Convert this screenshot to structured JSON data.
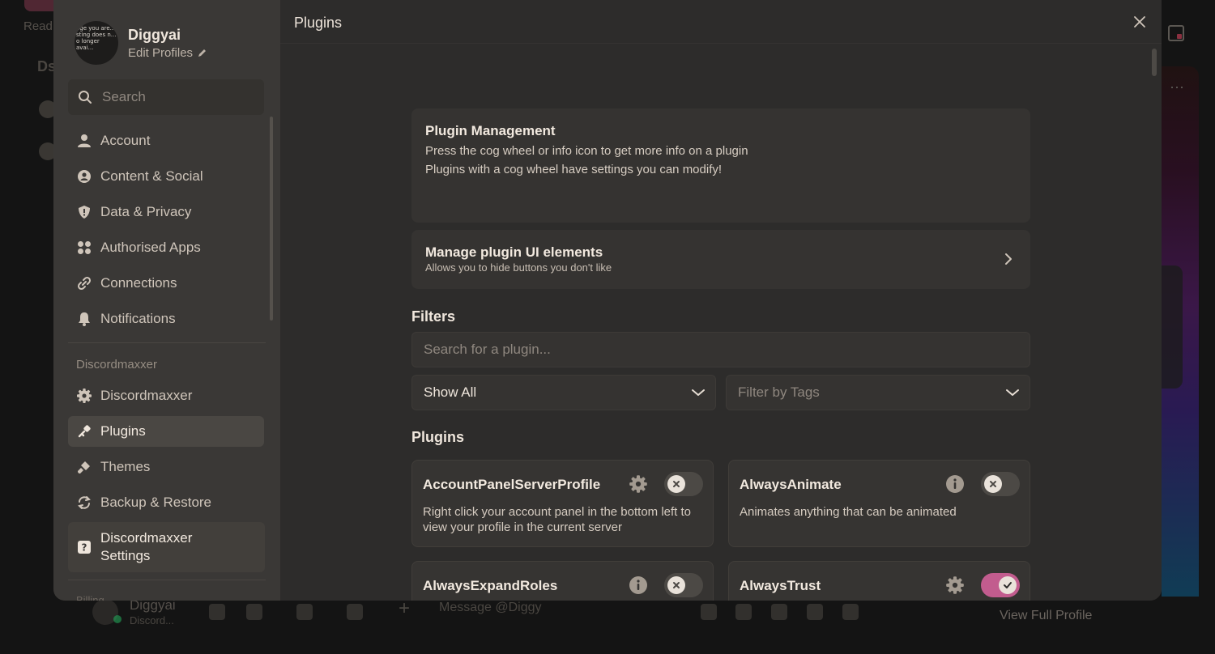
{
  "background": {
    "read_text": "Read",
    "ds_text": "Ds",
    "user": {
      "name": "Diggyai",
      "status": "Discord..."
    },
    "message_placeholder": "Message @Diggy",
    "view_full_profile": "View Full Profile"
  },
  "profile": {
    "name": "Diggyai",
    "edit_label": "Edit Profiles",
    "avatar_text": "age you are... sting does n... o longer avai..."
  },
  "sidebar": {
    "search_placeholder": "Search",
    "items": [
      {
        "label": "Account",
        "icon": "user-icon"
      },
      {
        "label": "Content & Social",
        "icon": "shield-user-icon"
      },
      {
        "label": "Data & Privacy",
        "icon": "shield-icon"
      },
      {
        "label": "Authorised Apps",
        "icon": "apps-icon"
      },
      {
        "label": "Connections",
        "icon": "link-icon"
      },
      {
        "label": "Notifications",
        "icon": "bell-icon"
      }
    ],
    "section_label": "Discordmaxxer",
    "section_items": [
      {
        "label": "Discordmaxxer",
        "icon": "gear-icon"
      },
      {
        "label": "Plugins",
        "icon": "puzzle-icon",
        "active": true
      },
      {
        "label": "Themes",
        "icon": "brush-icon"
      },
      {
        "label": "Backup & Restore",
        "icon": "sync-icon"
      },
      {
        "label": "Discordmaxxer Settings",
        "icon": "settings-box-icon"
      }
    ],
    "clipped_label": "Billing"
  },
  "main": {
    "title": "Plugins",
    "management": {
      "title": "Plugin Management",
      "line1": "Press the cog wheel or info icon to get more info on a plugin",
      "line2": "Plugins with a cog wheel have settings you can modify!"
    },
    "ui_elements": {
      "title": "Manage plugin UI elements",
      "subtitle": "Allows you to hide buttons you don't like"
    },
    "filters_heading": "Filters",
    "search_placeholder": "Search for a plugin...",
    "show_select": "Show All",
    "tags_placeholder": "Filter by Tags",
    "plugins_heading": "Plugins",
    "plugins": [
      {
        "name": "AccountPanelServerProfile",
        "description": "Right click your account panel in the bottom left to view your profile in the current server",
        "action": "gear-icon",
        "enabled": false
      },
      {
        "name": "AlwaysAnimate",
        "description": "Animates anything that can be animated",
        "action": "info-icon",
        "enabled": false
      },
      {
        "name": "AlwaysExpandRoles",
        "description": "",
        "action": "info-icon",
        "enabled": false
      },
      {
        "name": "AlwaysTrust",
        "description": "",
        "action": "gear-icon",
        "enabled": true
      }
    ]
  },
  "colors": {
    "accent_toggle_on": "#c25c8e",
    "modal_bg": "#2d2c2b",
    "sidebar_bg": "#3a3836"
  }
}
